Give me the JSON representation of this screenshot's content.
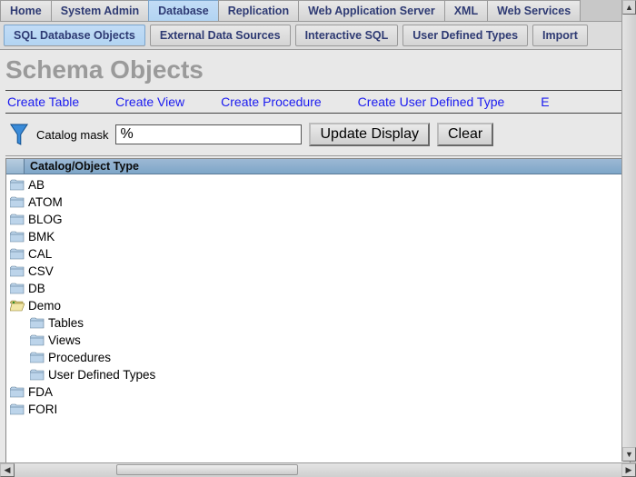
{
  "nav": {
    "tabs": [
      {
        "label": "Home",
        "active": false
      },
      {
        "label": "System Admin",
        "active": false
      },
      {
        "label": "Database",
        "active": true
      },
      {
        "label": "Replication",
        "active": false
      },
      {
        "label": "Web Application Server",
        "active": false
      },
      {
        "label": "XML",
        "active": false
      },
      {
        "label": "Web Services",
        "active": false
      }
    ],
    "subtabs": [
      {
        "label": "SQL Database Objects",
        "active": true
      },
      {
        "label": "External Data Sources",
        "active": false
      },
      {
        "label": "Interactive SQL",
        "active": false
      },
      {
        "label": "User Defined Types",
        "active": false
      },
      {
        "label": "Import",
        "active": false
      }
    ]
  },
  "page_title": "Schema Objects",
  "action_links": [
    "Create Table",
    "Create View",
    "Create Procedure",
    "Create User Defined Type",
    "E"
  ],
  "filter": {
    "label": "Catalog mask",
    "value": "%",
    "update_btn": "Update Display",
    "clear_btn": "Clear"
  },
  "tree": {
    "header": "Catalog/Object Type",
    "items": [
      {
        "label": "AB",
        "depth": 0,
        "open": false
      },
      {
        "label": "ATOM",
        "depth": 0,
        "open": false
      },
      {
        "label": "BLOG",
        "depth": 0,
        "open": false
      },
      {
        "label": "BMK",
        "depth": 0,
        "open": false
      },
      {
        "label": "CAL",
        "depth": 0,
        "open": false
      },
      {
        "label": "CSV",
        "depth": 0,
        "open": false
      },
      {
        "label": "DB",
        "depth": 0,
        "open": false
      },
      {
        "label": "Demo",
        "depth": 0,
        "open": true
      },
      {
        "label": "Tables",
        "depth": 1,
        "open": false
      },
      {
        "label": "Views",
        "depth": 1,
        "open": false
      },
      {
        "label": "Procedures",
        "depth": 1,
        "open": false
      },
      {
        "label": "User Defined Types",
        "depth": 1,
        "open": false
      },
      {
        "label": "FDA",
        "depth": 0,
        "open": false
      },
      {
        "label": "FORI",
        "depth": 0,
        "open": false
      }
    ]
  }
}
